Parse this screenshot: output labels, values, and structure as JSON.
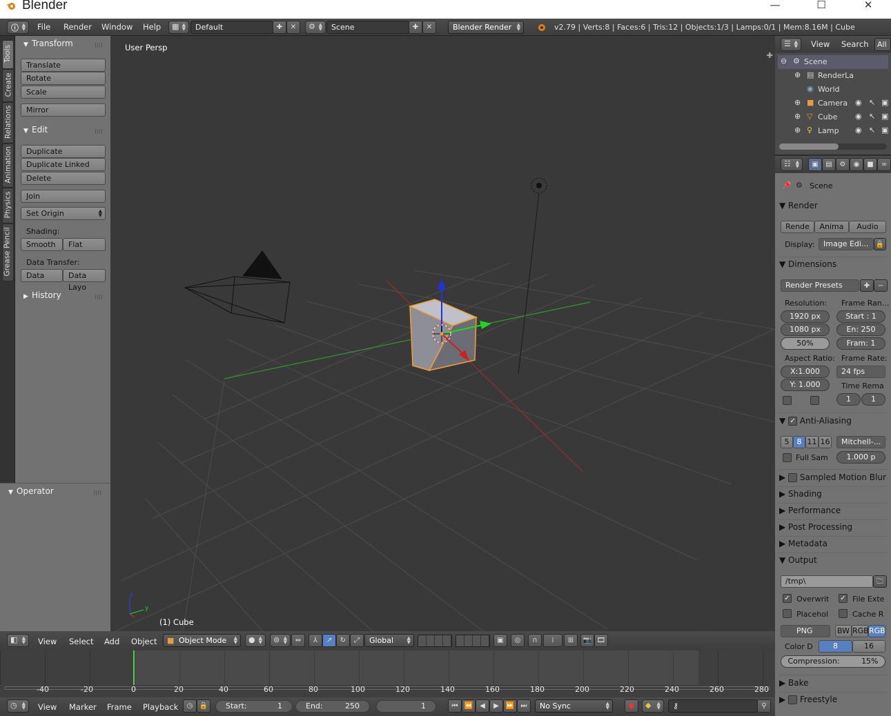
{
  "window": {
    "title": "Blender",
    "minimize": "—",
    "maximize": "☐",
    "close": "✕"
  },
  "topbar": {
    "menus": [
      "File",
      "Render",
      "Window",
      "Help"
    ],
    "screen_layout": "Default",
    "scene": "Scene",
    "engine": "Blender Render",
    "stats": "v2.79 | Verts:8 | Faces:6 | Tris:12 | Objects:1/3 | Lamps:0/1 | Mem:8.16M | Cube"
  },
  "toolshelf": {
    "tabs": [
      "Tools",
      "Create",
      "Relations",
      "Animation",
      "Physics",
      "Grease Pencil"
    ],
    "transform": {
      "title": "Transform",
      "buttons": [
        "Translate",
        "Rotate",
        "Scale",
        "Mirror"
      ]
    },
    "edit": {
      "title": "Edit",
      "buttons": [
        "Duplicate",
        "Duplicate Linked",
        "Delete",
        "Join"
      ],
      "set_origin": "Set Origin",
      "shading_label": "Shading:",
      "smooth": "Smooth",
      "flat": "Flat",
      "data_transfer_label": "Data Transfer:",
      "data": "Data",
      "data_layo": "Data Layo"
    },
    "history": "History",
    "operator": "Operator"
  },
  "viewport": {
    "label": "User Persp",
    "object_label": "(1) Cube"
  },
  "outliner": {
    "menus": [
      "View",
      "Search",
      "All"
    ],
    "rows": [
      {
        "name": "Scene"
      },
      {
        "name": "RenderLa"
      },
      {
        "name": "World"
      },
      {
        "name": "Camera"
      },
      {
        "name": "Cube"
      },
      {
        "name": "Lamp"
      }
    ]
  },
  "properties": {
    "context": "Scene",
    "render": {
      "title": "Render",
      "render_btn": "Rende",
      "anim_btn": "Anima",
      "audio_btn": "Audio",
      "display_label": "Display:",
      "display_value": "Image Edi..."
    },
    "dimensions": {
      "title": "Dimensions",
      "presets": "Render Presets",
      "resolution_label": "Resolution:",
      "res_x": "1920 px",
      "res_y": "1080 px",
      "res_pct": "50%",
      "frame_range_label": "Frame Ran...",
      "start": "Start : 1",
      "end": "En: 250",
      "step": "Fram: 1",
      "aspect_label": "Aspect Ratio:",
      "aspect_x": "X:1.000",
      "aspect_y": "Y: 1.000",
      "frame_rate_label": "Frame Rate:",
      "fps": "24 fps",
      "time_remap": "Time Rema",
      "remap_a": "1",
      "remap_b": "1"
    },
    "anti_aliasing": {
      "title": "Anti-Aliasing",
      "samples": [
        "5",
        "8",
        "11",
        "16"
      ],
      "filter": "Mitchell-...",
      "full_sample": "Full Sam",
      "size": "1.000 p"
    },
    "collapsed": [
      "Sampled Motion Blur",
      "Shading",
      "Performance",
      "Post Processing",
      "Metadata"
    ],
    "output": {
      "title": "Output",
      "path": "/tmp\\",
      "overwrite": "Overwrit",
      "file_ext": "File Exte",
      "placeholder": "Placehol",
      "cache": "Cache R",
      "format": "PNG",
      "color_modes": [
        "BW",
        "RGB",
        "RGB"
      ],
      "color_depth_label": "Color D",
      "depths": [
        "8",
        "16"
      ],
      "compression_label": "Compression:",
      "compression": "15%"
    },
    "bake": "Bake",
    "freestyle": "Freestyle"
  },
  "view3d_header": {
    "menus": [
      "View",
      "Select",
      "Add",
      "Object"
    ],
    "mode": "Object Mode",
    "orientation": "Global"
  },
  "timeline": {
    "ticks": [
      "-40",
      "-20",
      "0",
      "20",
      "40",
      "60",
      "80",
      "100",
      "120",
      "140",
      "160",
      "180",
      "200",
      "220",
      "240",
      "260",
      "280"
    ],
    "menus": [
      "View",
      "Marker",
      "Frame",
      "Playback"
    ],
    "start_label": "Start:",
    "start": "1",
    "end_label": "End:",
    "end": "250",
    "current": "1",
    "sync": "No Sync"
  }
}
